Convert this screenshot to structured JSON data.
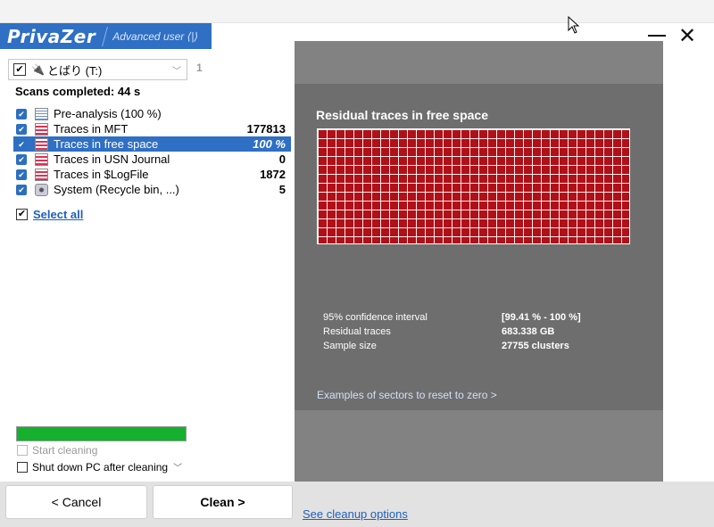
{
  "app": {
    "logo_text": "PrivaZer",
    "mode_label": "Advanced user ⟨|⟩"
  },
  "drive": {
    "label": "とばり (T:)",
    "count": "1"
  },
  "scans_completed": "Scans completed: 44 s",
  "scan_items": [
    {
      "label": "Pre-analysis (100 %)",
      "value": "",
      "icon": "grid-icon",
      "checked": true,
      "selected": false
    },
    {
      "label": "Traces in MFT",
      "value": "177813",
      "icon": "table-icon",
      "checked": true,
      "selected": false
    },
    {
      "label": "Traces in free space",
      "value": "100 %",
      "icon": "free-space-icon",
      "checked": true,
      "selected": true
    },
    {
      "label": "Traces in USN Journal",
      "value": "0",
      "icon": "table-icon",
      "checked": true,
      "selected": false
    },
    {
      "label": "Traces in $LogFile",
      "value": "1872",
      "icon": "table-icon",
      "checked": true,
      "selected": false
    },
    {
      "label": "System (Recycle bin, ...)",
      "value": "5",
      "icon": "system-icon",
      "checked": true,
      "selected": false
    }
  ],
  "select_all": "Select all",
  "progress": 1.0,
  "options": {
    "start_cleaning": "Start cleaning",
    "shutdown": "Shut down PC after cleaning"
  },
  "panel": {
    "title": "Residual traces in free space",
    "stats": [
      {
        "label": "95% confidence interval",
        "value": "[99.41 % - 100 %]"
      },
      {
        "label": "Residual traces",
        "value": "683.338 GB"
      },
      {
        "label": "Sample size",
        "value": "27755 clusters"
      }
    ],
    "examples_link": "Examples of sectors to reset to zero >"
  },
  "buttons": {
    "cancel": "< Cancel",
    "clean": "Clean >",
    "see_options": "See cleanup options"
  },
  "colors": {
    "accent": "#2f6fc4",
    "residual_red": "#b01018",
    "progress_green": "#15b02e"
  }
}
